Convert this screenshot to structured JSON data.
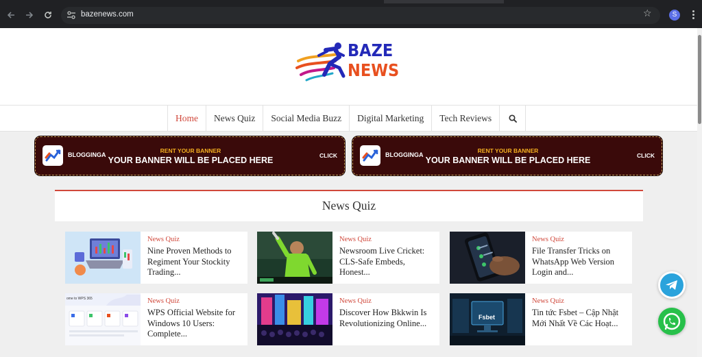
{
  "browser": {
    "url": "bazenews.com",
    "profile_initial": "S",
    "back_icon": "arrow-left-icon",
    "forward_icon": "arrow-right-icon",
    "reload_icon": "reload-icon",
    "bookmark_icon": "star-icon",
    "menu_icon": "kebab-menu-icon"
  },
  "logo": {
    "line1": "BAZE",
    "line2": "NEWS"
  },
  "nav": {
    "items": [
      {
        "label": "Home",
        "active": true
      },
      {
        "label": "News Quiz"
      },
      {
        "label": "Social Media Buzz"
      },
      {
        "label": "Digital Marketing"
      },
      {
        "label": "Tech Reviews"
      }
    ],
    "search_icon": "search-icon"
  },
  "banners": [
    {
      "brand": "BLOGGINGA",
      "kicker": "RENT YOUR BANNER",
      "headline": "YOUR BANNER WILL BE PLACED HERE",
      "cta": "CLICK"
    },
    {
      "brand": "BLOGGINGA",
      "kicker": "RENT YOUR BANNER",
      "headline": "YOUR BANNER WILL BE PLACED HERE",
      "cta": "CLICK"
    }
  ],
  "section": {
    "title": "News Quiz"
  },
  "cards": [
    {
      "category": "News Quiz",
      "title": "Nine Proven Methods to Regiment Your Stockity Trading..."
    },
    {
      "category": "News Quiz",
      "title": "Newsroom Live Cricket: CLS-Safe Embeds, Honest..."
    },
    {
      "category": "News Quiz",
      "title": "File Transfer Tricks on WhatsApp Web Version Login and..."
    },
    {
      "category": "News Quiz",
      "title": "WPS Official Website for Windows 10 Users: Complete..."
    },
    {
      "category": "News Quiz",
      "title": "Discover How Bkkwin Is Revolutionizing Online..."
    },
    {
      "category": "News Quiz",
      "title": "Tin tức Fsbet – Cập Nhật Mới Nhất Về Các Hoạt..."
    }
  ],
  "thumb_texts": {
    "fsbet": "Fsbet",
    "wps": "ome to WPS 365"
  },
  "floating": {
    "telegram_icon": "telegram-icon",
    "whatsapp_icon": "whatsapp-icon"
  },
  "colors": {
    "accent": "#d0473a",
    "banner_bg": "#3a0a0a",
    "banner_kicker": "#f5b020",
    "logo_blue": "#2329b8",
    "logo_orange": "#e8501f"
  }
}
